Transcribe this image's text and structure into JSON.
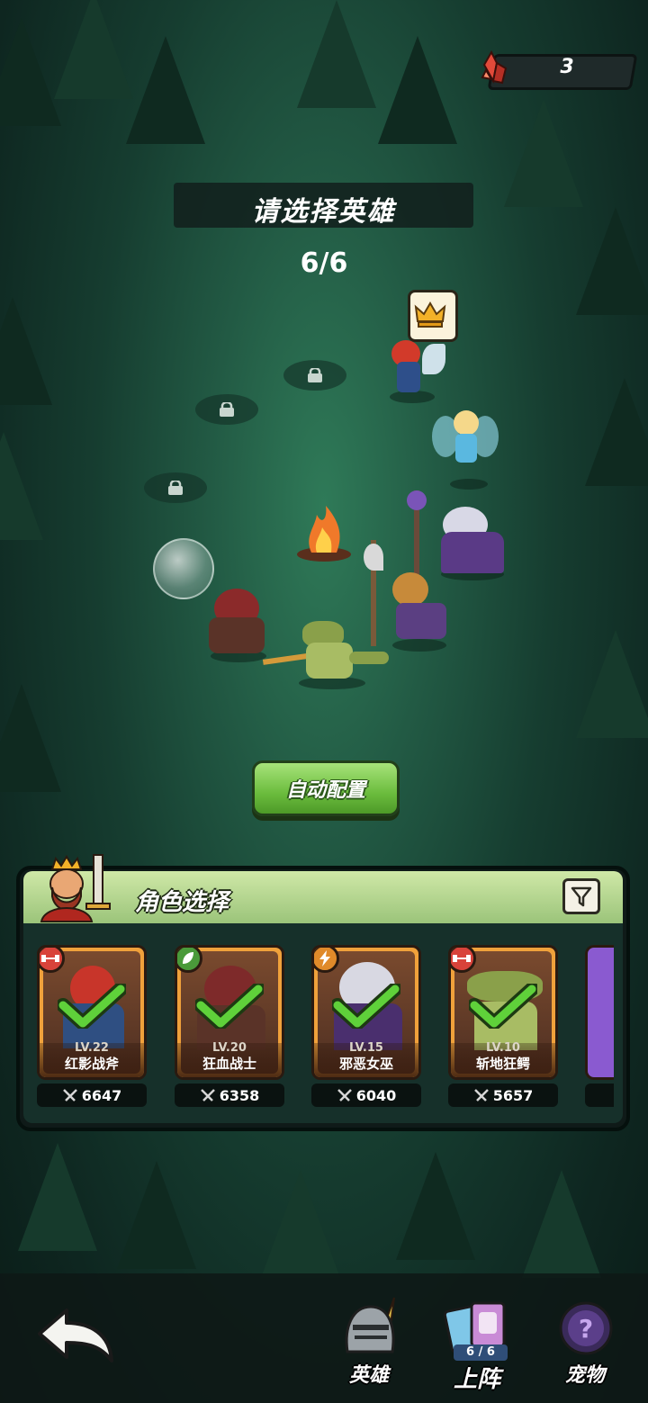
{
  "currency": {
    "icon": "red-crystal-icon",
    "amount": "3"
  },
  "selection": {
    "title": "请选择英雄",
    "count": "6/6"
  },
  "leader_icon": "crown-icon",
  "auto_button": {
    "label": "自动配置"
  },
  "panel": {
    "title": "角色选择",
    "filter_icon": "filter-icon"
  },
  "heroes": [
    {
      "level": "LV.22",
      "name": "红影战斧",
      "power": "6647",
      "class_icon": "dumbbell-icon",
      "selected": true
    },
    {
      "level": "LV.20",
      "name": "狂血战士",
      "power": "6358",
      "class_icon": "leaf-icon",
      "selected": true
    },
    {
      "level": "LV.15",
      "name": "邪恶女巫",
      "power": "6040",
      "class_icon": "lightning-icon",
      "selected": true
    },
    {
      "level": "LV.10",
      "name": "斩地狂鳄",
      "power": "5657",
      "class_icon": "dumbbell-icon",
      "selected": true
    }
  ],
  "bottom_nav": {
    "back_icon": "back-arrow-icon",
    "items": [
      {
        "label": "英雄",
        "icon": "knight-helmet-icon"
      },
      {
        "label": "上阵",
        "icon": "formation-cards-icon",
        "badge": "6 / 6",
        "active": true
      },
      {
        "label": "宠物",
        "icon": "mystery-egg-icon"
      }
    ]
  },
  "colors": {
    "accent_green": "#6bbc3d",
    "card_orange": "#f0a13b",
    "check_green": "#5fd13a"
  }
}
